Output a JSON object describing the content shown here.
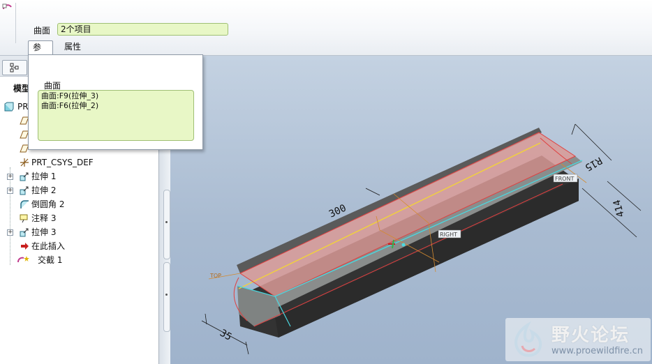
{
  "dashboard": {
    "surface_label": "曲面",
    "surface_value": "2个项目",
    "tabs": [
      {
        "label": "参照",
        "active": true
      },
      {
        "label": "属性",
        "active": false
      }
    ]
  },
  "ref_panel": {
    "caption": "曲面",
    "items": [
      "曲面:F9(拉伸_3)",
      "曲面:F6(拉伸_2)"
    ]
  },
  "model_tree": {
    "title": "模型",
    "items": [
      {
        "label": "PRT",
        "icon": "part-icon"
      },
      {
        "label": "",
        "icon": "datum-plane-icon"
      },
      {
        "label": "",
        "icon": "datum-plane-icon"
      },
      {
        "label": "",
        "icon": "datum-plane-icon"
      },
      {
        "label": "PRT_CSYS_DEF",
        "icon": "csys-icon"
      },
      {
        "label": "拉伸 1",
        "icon": "extrude-icon",
        "expandable": true
      },
      {
        "label": "拉伸 2",
        "icon": "extrude-icon",
        "expandable": true
      },
      {
        "label": "倒圆角 2",
        "icon": "round-icon"
      },
      {
        "label": "注释 3",
        "icon": "note-icon"
      },
      {
        "label": "拉伸 3",
        "icon": "extrude-icon",
        "expandable": true
      },
      {
        "label": "在此插入",
        "icon": "insert-arrow-icon"
      },
      {
        "label": "交截 1",
        "icon": "intersect-icon"
      }
    ]
  },
  "graphics": {
    "dimensions": [
      "R15",
      "300",
      "414",
      "35"
    ],
    "datum_labels": [
      "TOP",
      "FRONT",
      "RIGHT"
    ]
  },
  "watermark": {
    "title": "野火论坛",
    "url": "www.proewildfire.cn"
  },
  "colors": {
    "field_bg": "#e8f7c6",
    "viewport_top": "#c4d2e2",
    "viewport_bottom": "#9fb3cc",
    "surface_pink": "#d99a96",
    "edge_cyan": "#4ad8e0",
    "edge_yellow": "#f2d23a"
  }
}
